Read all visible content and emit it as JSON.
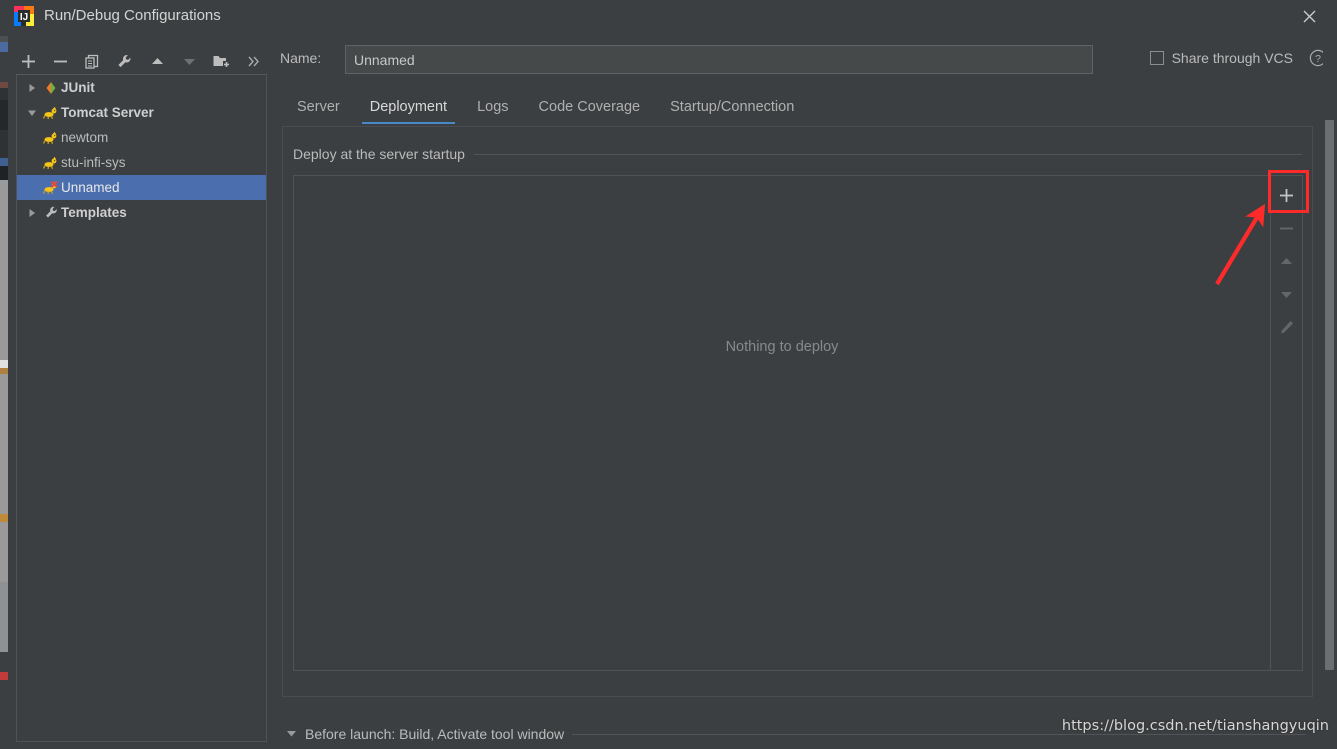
{
  "window": {
    "title": "Run/Debug Configurations",
    "app_icon": "intellij-idea-icon",
    "close_label": "✕"
  },
  "colors": {
    "window_bg": "#3c3f41",
    "selection_blue": "#4b6eaf",
    "tab_accent": "#4a88c7",
    "annotation_red": "#ff2b2b",
    "text_primary": "#bbbbbb",
    "border": "#4f5355"
  },
  "left_toolbar": {
    "buttons": [
      {
        "name": "add-configuration-button",
        "icon": "plus-icon",
        "label": "+",
        "enabled": true
      },
      {
        "name": "remove-configuration-button",
        "icon": "minus-icon",
        "label": "−",
        "enabled": true
      },
      {
        "name": "copy-configuration-button",
        "icon": "copy-icon",
        "label": "Copy Configuration",
        "enabled": true
      },
      {
        "name": "edit-templates-button",
        "icon": "wrench-icon",
        "label": "Edit Templates",
        "enabled": true
      },
      {
        "name": "move-up-button",
        "icon": "arrow-up-icon",
        "label": "Move Up",
        "enabled": true
      },
      {
        "name": "move-down-button",
        "icon": "arrow-down-icon",
        "label": "Move Down",
        "enabled": false
      },
      {
        "name": "new-folder-button",
        "icon": "folder-add-icon",
        "label": "Create New Folder",
        "enabled": true
      },
      {
        "name": "more-options-button",
        "icon": "chevron-double-right-icon",
        "label": "»",
        "enabled": true
      }
    ]
  },
  "tree": {
    "items": [
      {
        "label": "JUnit",
        "icon": "junit-icon",
        "twisty": "collapsed",
        "depth": 0,
        "bold": true,
        "selected": false
      },
      {
        "label": "Tomcat Server",
        "icon": "tomcat-icon",
        "twisty": "expanded",
        "depth": 0,
        "bold": true,
        "selected": false
      },
      {
        "label": "newtom",
        "icon": "tomcat-icon",
        "twisty": "none",
        "depth": 1,
        "bold": false,
        "selected": false
      },
      {
        "label": "stu-infi-sys",
        "icon": "tomcat-icon",
        "twisty": "none",
        "depth": 1,
        "bold": false,
        "selected": false
      },
      {
        "label": "Unnamed",
        "icon": "tomcat-error-icon",
        "twisty": "none",
        "depth": 1,
        "bold": false,
        "selected": true
      },
      {
        "label": "Templates",
        "icon": "wrench-icon",
        "twisty": "collapsed",
        "depth": 0,
        "bold": true,
        "selected": false
      }
    ]
  },
  "form": {
    "name_label": "Name:",
    "name_value": "Unnamed",
    "name_placeholder": "Unnamed",
    "share_vcs_label": "Share through VCS",
    "share_vcs_checked": false,
    "help_icon": "question-mark-circle-icon"
  },
  "tabs": {
    "items": [
      {
        "label": "Server",
        "active": false
      },
      {
        "label": "Deployment",
        "active": true
      },
      {
        "label": "Logs",
        "active": false
      },
      {
        "label": "Code Coverage",
        "active": false
      },
      {
        "label": "Startup/Connection",
        "active": false
      }
    ]
  },
  "deployment": {
    "group_title": "Deploy at the server startup",
    "empty_message": "Nothing to deploy",
    "side_toolbar": [
      {
        "name": "add-artifact-button",
        "icon": "plus-icon",
        "label": "+",
        "enabled": true,
        "highlighted": true
      },
      {
        "name": "remove-artifact-button",
        "icon": "minus-icon",
        "label": "−",
        "enabled": false,
        "highlighted": false
      },
      {
        "name": "move-artifact-up-button",
        "icon": "arrow-up-icon",
        "label": "Move Up",
        "enabled": false,
        "highlighted": false
      },
      {
        "name": "move-artifact-down-button",
        "icon": "arrow-down-icon",
        "label": "Move Down",
        "enabled": false,
        "highlighted": false
      },
      {
        "name": "edit-artifact-button",
        "icon": "pencil-icon",
        "label": "Edit",
        "enabled": false,
        "highlighted": false
      }
    ]
  },
  "before_launch": {
    "twisty": "expanded",
    "label": "Before launch: Build, Activate tool window"
  },
  "watermark": {
    "text": "https://blog.csdn.net/tianshangyuqin"
  },
  "annotation": {
    "type": "red-arrow-pointing-to-add-button",
    "target": "add-artifact-button"
  }
}
